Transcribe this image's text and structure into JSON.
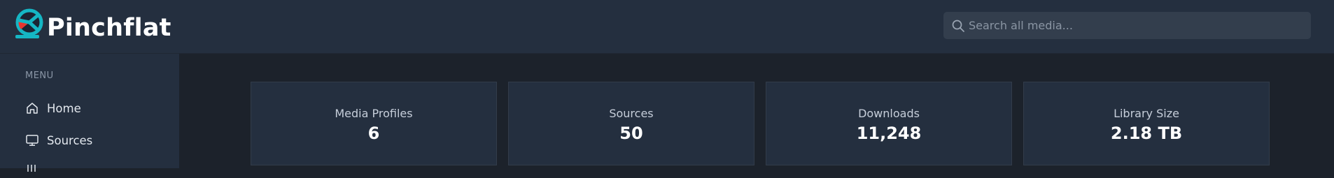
{
  "app": {
    "name": "Pinchflat"
  },
  "search": {
    "placeholder": "Search all media..."
  },
  "sidebar": {
    "heading": "MENU",
    "items": [
      {
        "label": "Home",
        "icon": "home-icon"
      },
      {
        "label": "Sources",
        "icon": "monitor-icon"
      },
      {
        "label": "",
        "icon": "list-icon"
      }
    ]
  },
  "stats": [
    {
      "label": "Media Profiles",
      "value": "6"
    },
    {
      "label": "Sources",
      "value": "50"
    },
    {
      "label": "Downloads",
      "value": "11,248"
    },
    {
      "label": "Library Size",
      "value": "2.18 TB"
    }
  ],
  "colors": {
    "header_bg": "#242f3f",
    "page_bg": "#1c222b",
    "logo_teal": "#15b6c4",
    "logo_red": "#e8352f"
  }
}
